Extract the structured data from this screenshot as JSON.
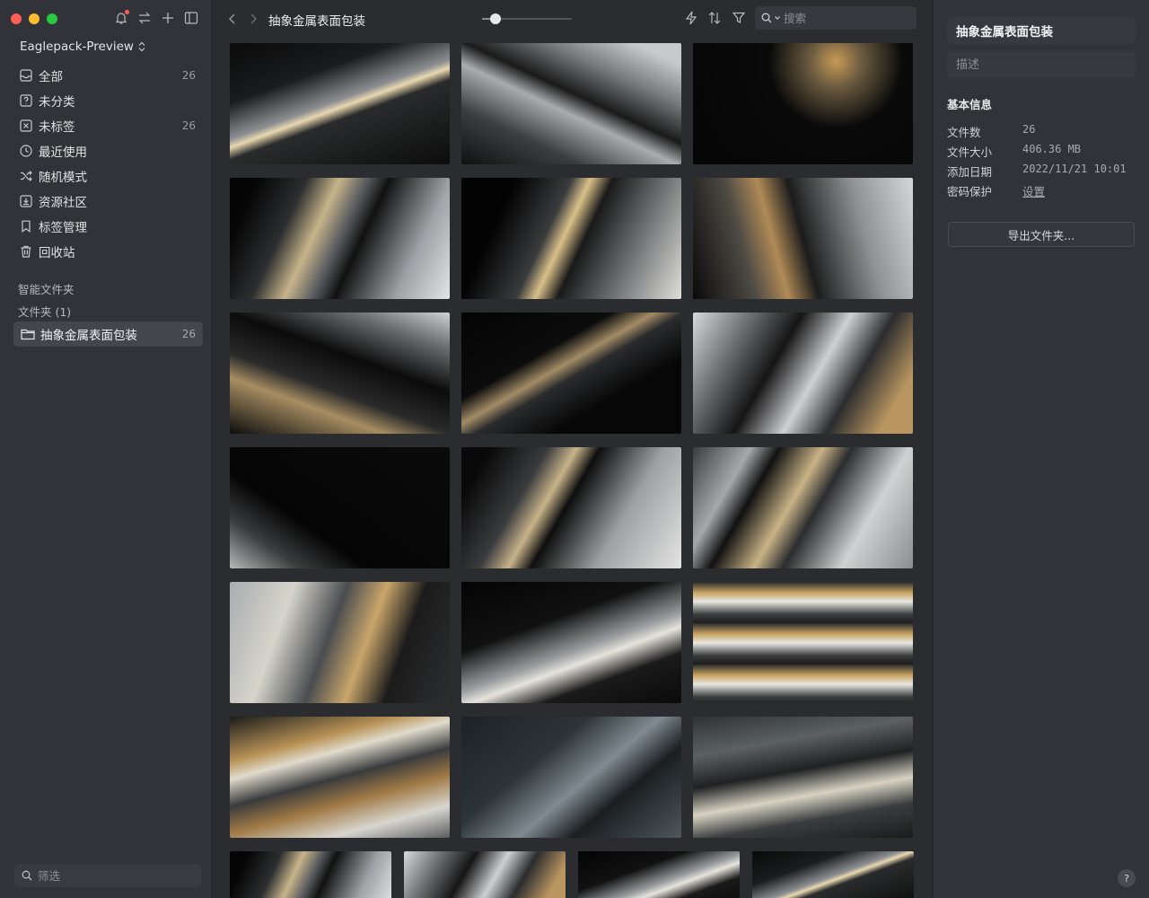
{
  "sidebar": {
    "library_name": "Eaglepack-Preview",
    "nav": [
      {
        "name": "nav-all",
        "icon": "inbox-icon",
        "label": "全部",
        "count": "26"
      },
      {
        "name": "nav-uncategorized",
        "icon": "question-box-icon",
        "label": "未分类",
        "count": ""
      },
      {
        "name": "nav-untagged",
        "icon": "untagged-icon",
        "label": "未标签",
        "count": "26"
      },
      {
        "name": "nav-recent",
        "icon": "clock-icon",
        "label": "最近使用",
        "count": ""
      },
      {
        "name": "nav-random",
        "icon": "shuffle-icon",
        "label": "随机模式",
        "count": ""
      },
      {
        "name": "nav-community",
        "icon": "download-box-icon",
        "label": "资源社区",
        "count": ""
      },
      {
        "name": "nav-tags",
        "icon": "bookmark-icon",
        "label": "标签管理",
        "count": ""
      },
      {
        "name": "nav-trash",
        "icon": "trash-icon",
        "label": "回收站",
        "count": ""
      }
    ],
    "smart_folders_title": "智能文件夹",
    "folders_title": "文件夹 (1)",
    "folder": {
      "label": "抽象金属表面包装",
      "count": "26"
    },
    "filter_placeholder": "筛选"
  },
  "toolbar": {
    "breadcrumb": "抽象金属表面包装",
    "zoom_fraction": 0.15,
    "search_placeholder": "搜索"
  },
  "inspector": {
    "title": "抽象金属表面包装",
    "description_placeholder": "描述",
    "info_title": "基本信息",
    "rows": [
      {
        "key": "文件数",
        "value": "26"
      },
      {
        "key": "文件大小",
        "value": "406.36 MB"
      },
      {
        "key": "添加日期",
        "value": "2022/11/21 10:01"
      },
      {
        "key": "密码保护",
        "value": "设置"
      }
    ],
    "export_label": "导出文件夹...",
    "help_label": "?"
  },
  "colors": {
    "close": "#ff5f57",
    "minimize": "#febc2e",
    "zoom": "#28c840",
    "accent_gold": "#d8a85a"
  }
}
